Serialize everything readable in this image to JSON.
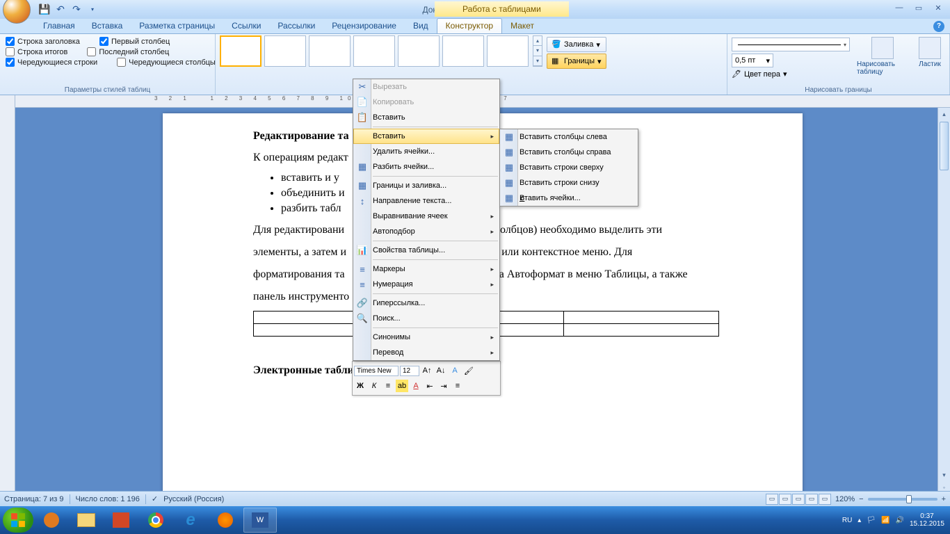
{
  "title": "Документ1 - Microsoft Word",
  "contextual_tab_title": "Работа с таблицами",
  "ribbon": {
    "tabs": [
      "Главная",
      "Вставка",
      "Разметка страницы",
      "Ссылки",
      "Рассылки",
      "Рецензирование",
      "Вид",
      "Конструктор",
      "Макет"
    ],
    "active_tab": "Конструктор",
    "groups": {
      "table_style_options": {
        "label": "Параметры стилей таблиц",
        "header_row": "Строка заголовка",
        "total_row": "Строка итогов",
        "banded_rows": "Чередующиеся строки",
        "first_column": "Первый столбец",
        "last_column": "Последний столбец",
        "banded_columns": "Чередующиеся столбцы"
      },
      "shading": "Заливка",
      "borders": "Границы",
      "draw_borders": {
        "label": "Нарисовать границы",
        "width": "0,5 пт",
        "pen_color": "Цвет пера",
        "draw_table": "Нарисовать таблицу",
        "eraser": "Ластик"
      }
    }
  },
  "context_menu": {
    "cut": "Вырезать",
    "copy": "Копировать",
    "paste_simple": "Вставить",
    "insert": "Вставить",
    "delete_cells": "Удалить ячейки...",
    "split_cells": "Разбить ячейки...",
    "borders_shading": "Границы и заливка...",
    "text_direction": "Направление текста...",
    "cell_alignment": "Выравнивание ячеек",
    "autofit": "Автоподбор",
    "table_properties": "Свойства таблицы...",
    "bullets": "Маркеры",
    "numbering": "Нумерация",
    "hyperlink": "Гиперссылка...",
    "lookup": "Поиск...",
    "synonyms": "Синонимы",
    "translate": "Перевод"
  },
  "submenu": {
    "insert_cols_left": "Вставить столбцы слева",
    "insert_cols_right": "Вставить столбцы справа",
    "insert_rows_above": "Вставить строки сверху",
    "insert_rows_below": "Вставить строки снизу",
    "insert_cells": "Вставить ячейки..."
  },
  "mini_toolbar": {
    "font": "Times New",
    "size": "12"
  },
  "document": {
    "heading1": "Редактирование та",
    "para1": "К операциям редакт",
    "li1": "вставить и у",
    "li2": "объединить и",
    "li3": "разбить табл",
    "para2a": "Для редактировани",
    "para2b": "столбцов) необходимо выделить эти",
    "para3a": "элементы, а затем и",
    "para3b": "а или контекстное меню. Для",
    "para4a": "форматирования та",
    "para4b": "да Автоформат в меню Таблицы, а также",
    "para5": "панель инструменто",
    "heading2": "Электронные таблицы Word"
  },
  "statusbar": {
    "page": "Страница: 7 из 9",
    "words": "Число слов: 1 196",
    "language": "Русский (Россия)",
    "zoom": "120%"
  },
  "system": {
    "lang": "RU",
    "time": "0:37",
    "date": "15.12.2015"
  }
}
